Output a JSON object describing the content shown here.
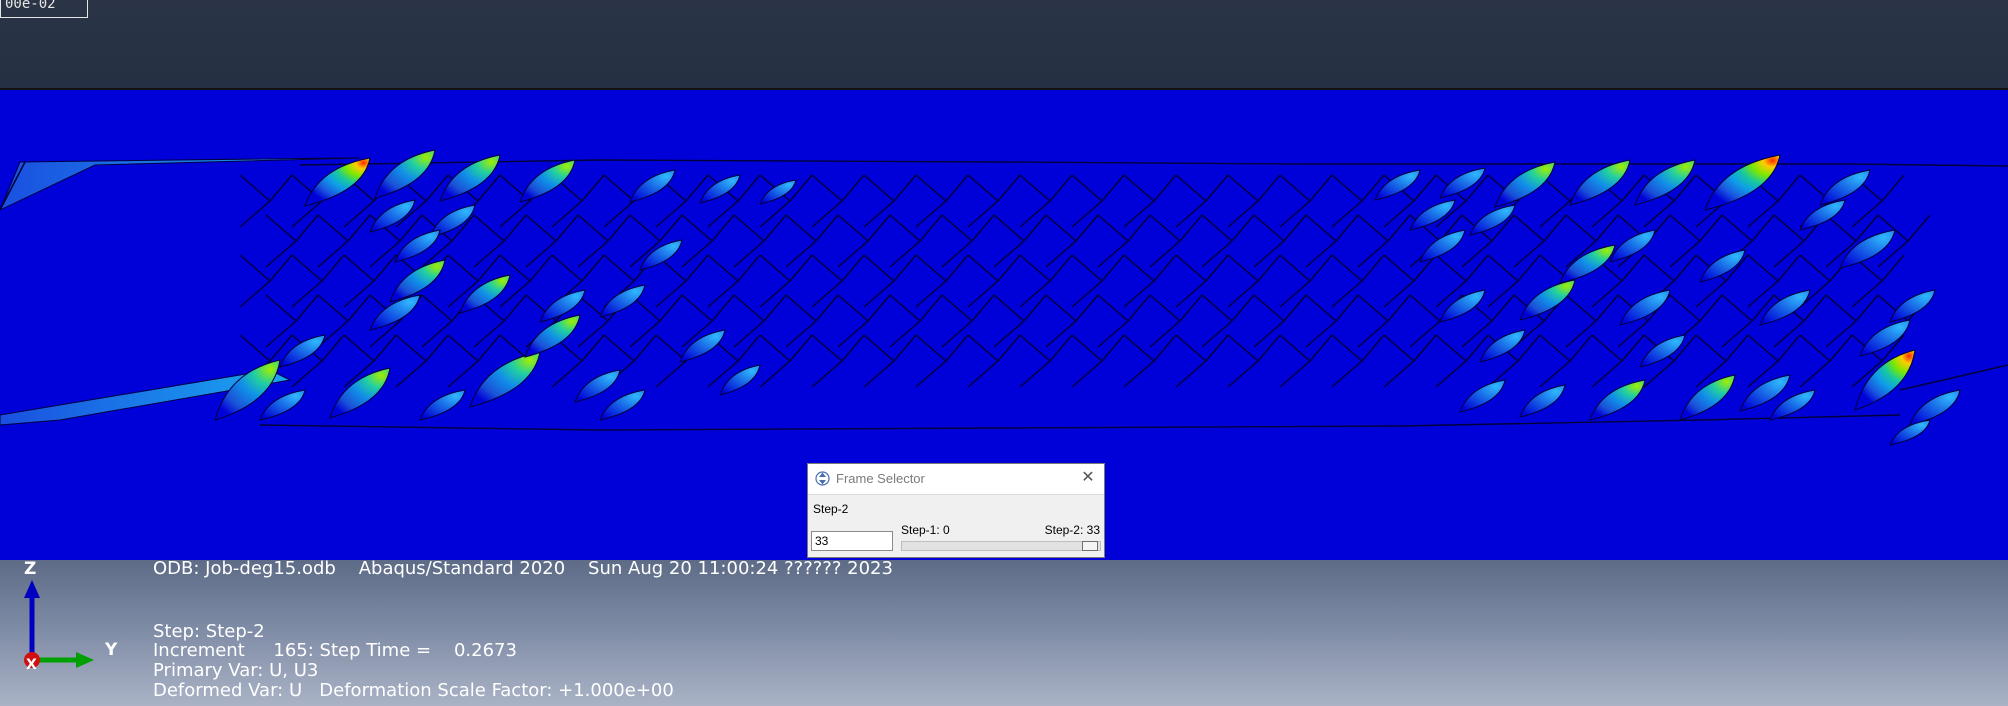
{
  "legend": {
    "value_fragment": "00e-02"
  },
  "dialog": {
    "title": "Frame Selector",
    "step_label": "Step-2",
    "frame_value": "33",
    "range_min_label": "Step-1: 0",
    "range_max_label": "Step-2: 33",
    "slider_fraction": 1.0
  },
  "info": {
    "odb_line": "ODB: Job-deg15.odb    Abaqus/Standard 2020    Sun Aug 20 11:00:24 ?????? 2023",
    "step_line": "Step: Step-2",
    "increment_line": "Increment     165: Step Time =    0.2673",
    "primary_var_line": "Primary Var: U, U3",
    "deformed_var_line": "Deformed Var: U   Deformation Scale Factor: +1.000e+00"
  },
  "triad": {
    "z_label": "Z",
    "y_label": "Y",
    "x_label": "X"
  },
  "colors": {
    "background_field": "#0000d8",
    "peak": "#ff3000",
    "mid": "#2ec9ff"
  }
}
